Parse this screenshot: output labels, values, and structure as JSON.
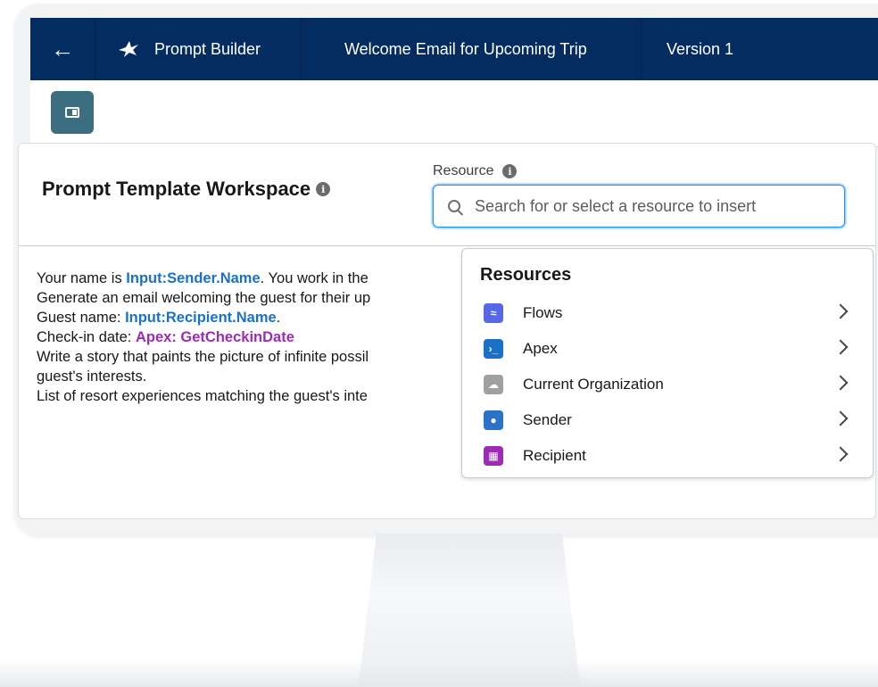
{
  "header": {
    "back_icon": "arrow-left-icon",
    "app_icon": "hummingbird-icon",
    "app_name": "Prompt Builder",
    "template_name": "Welcome Email for Upcoming Trip",
    "version": "Version 1"
  },
  "toolbar": {
    "panel_toggle_icon": "panel-toggle-icon"
  },
  "workspace": {
    "title": "Prompt Template Workspace",
    "info_glyph": "i",
    "resource_label": "Resource",
    "search_placeholder": "Search for or select a resource to insert",
    "lines": [
      {
        "pre": "Your name is ",
        "token": "Input:Sender.Name",
        "post": ". You work in the"
      },
      {
        "pre": "Generate an email welcoming the guest for their up",
        "token": "",
        "post": ""
      },
      {
        "pre": "Guest name: ",
        "token": "Input:Recipient.Name",
        "post": "."
      },
      {
        "pre": "Check-in date: ",
        "token": "Apex: GetCheckinDate",
        "post": ""
      },
      {
        "pre": "Write a story that paints the picture of infinite possil",
        "token": "",
        "post": ""
      },
      {
        "pre": "guest's interests.",
        "token": "",
        "post": ""
      },
      {
        "pre": "List of resort experiences matching the guest's inte",
        "token": "",
        "post": ""
      }
    ]
  },
  "resources": {
    "title": "Resources",
    "items": [
      {
        "label": "Flows",
        "icon": "flow-icon",
        "color": "#5867e8"
      },
      {
        "label": "Apex",
        "icon": "apex-icon",
        "color": "#1b71c7"
      },
      {
        "label": "Current Organization",
        "icon": "cloud-icon",
        "color": "#a0a0a0"
      },
      {
        "label": "Sender",
        "icon": "user-icon",
        "color": "#2a73c8"
      },
      {
        "label": "Recipient",
        "icon": "contact-card-icon",
        "color": "#9b2cb5"
      }
    ]
  },
  "colors": {
    "header_bg": "#032d60",
    "token_blue": "#1b71c7",
    "token_purple": "#9b2cb5",
    "focus_blue": "#1b96ff"
  }
}
